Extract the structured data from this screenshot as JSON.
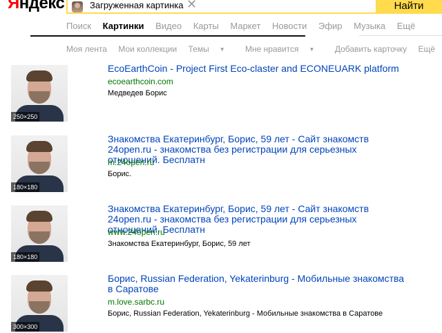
{
  "header": {
    "logo_first": "Я",
    "logo_rest": "ндекс",
    "search_value": "Загруженная картинка",
    "find_label": "Найти"
  },
  "tabs": [
    {
      "label": "Поиск"
    },
    {
      "label": "Картинки",
      "active": true
    },
    {
      "label": "Видео"
    },
    {
      "label": "Карты"
    },
    {
      "label": "Маркет"
    },
    {
      "label": "Новости"
    },
    {
      "label": "Эфир"
    },
    {
      "label": "Музыка"
    },
    {
      "label": "Ещё"
    }
  ],
  "subnav": [
    {
      "label": "Моя лента"
    },
    {
      "label": "Мои коллекции"
    },
    {
      "label": "Темы"
    },
    {
      "label": "Мне нравится"
    },
    {
      "label": "Добавить карточку"
    },
    {
      "label": "Ещё"
    }
  ],
  "results": [
    {
      "title": "EcoEarthCoin - Project First Eco-claster and ECONEUARK platform",
      "url": "ecoearthcoin.com",
      "desc": "Медведев Борис",
      "size": "250×250"
    },
    {
      "title": "Знакомства Екатеринбург, Борис, 59 лет - Сайт знакомств 24open.ru - знакомства без регистрации для серьезных отношений. Бесплатн",
      "url": "m.24open.ru",
      "desc": "Борис.",
      "size": "180×180"
    },
    {
      "title": "Знакомства Екатеринбург, Борис, 59 лет - Сайт знакомств 24open.ru - знакомства без регистрации для серьезных отношений. Бесплатн",
      "url": "www.24open.ru",
      "desc": "Знакомства Екатеринбург, Борис, 59 лет",
      "size": "180×180"
    },
    {
      "title": "Борис, Russian Federation, Yekaterinburg - Мобильные знакомства в Саратове",
      "url": "m.love.sarbc.ru",
      "desc": "Борис, Russian Federation, Yekaterinburg - Мобильные знакомства в Саратове",
      "size": "300×300"
    }
  ]
}
